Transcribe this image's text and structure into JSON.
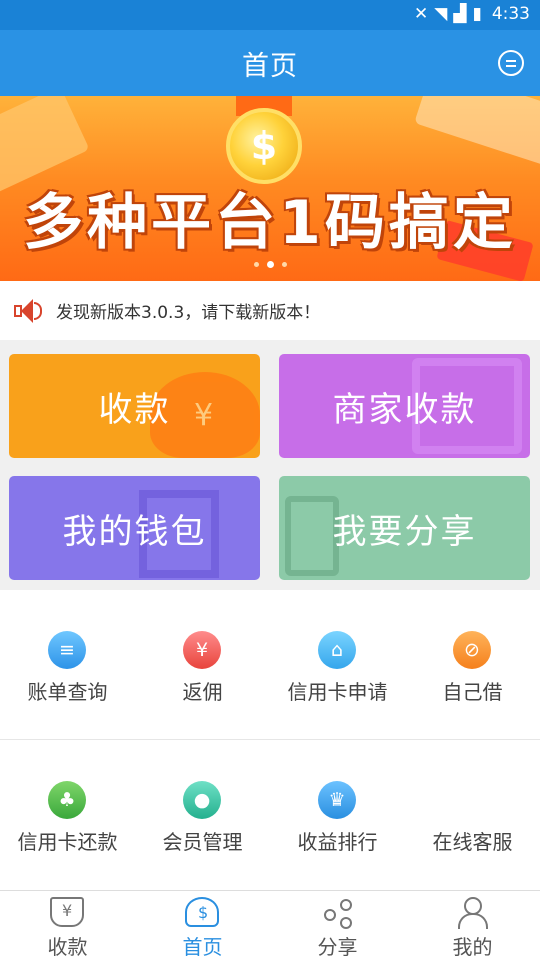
{
  "status_bar": {
    "time": "4:33",
    "icons": [
      "mute-icon",
      "wifi-icon",
      "signal-icon",
      "battery-charging-icon"
    ]
  },
  "header": {
    "title": "首页",
    "message_icon": "message-icon"
  },
  "banner": {
    "slogan": "多种平台1码搞定",
    "slide_count": 3,
    "active_slide": 2
  },
  "notice": {
    "icon": "speaker-icon",
    "text": "发现新版本3.0.3，请下载新版本！"
  },
  "tiles": [
    {
      "label": "收款",
      "color": "#f9a11b"
    },
    {
      "label": "商家收款",
      "color": "#c76ee8"
    },
    {
      "label": "我的钱包",
      "color": "#8676ea"
    },
    {
      "label": "我要分享",
      "color": "#8ccaa8"
    }
  ],
  "grid": {
    "row1": [
      {
        "label": "账单查询",
        "icon": "bill-icon"
      },
      {
        "label": "返佣",
        "icon": "rebate-icon"
      },
      {
        "label": "信用卡申请",
        "icon": "card-apply-icon"
      },
      {
        "label": "自己借",
        "icon": "compass-icon"
      }
    ],
    "row2": [
      {
        "label": "信用卡还款",
        "icon": "plant-icon"
      },
      {
        "label": "会员管理",
        "icon": "member-icon"
      },
      {
        "label": "收益排行",
        "icon": "crown-icon"
      },
      {
        "label": "在线客服",
        "icon": "headset-icon"
      }
    ]
  },
  "tabbar": {
    "items": [
      {
        "label": "收款",
        "icon": "collect-icon",
        "active": false
      },
      {
        "label": "首页",
        "icon": "home-icon",
        "active": true
      },
      {
        "label": "分享",
        "icon": "share-icon",
        "active": false
      },
      {
        "label": "我的",
        "icon": "profile-icon",
        "active": false
      }
    ],
    "active_color": "#2a8fe0"
  }
}
